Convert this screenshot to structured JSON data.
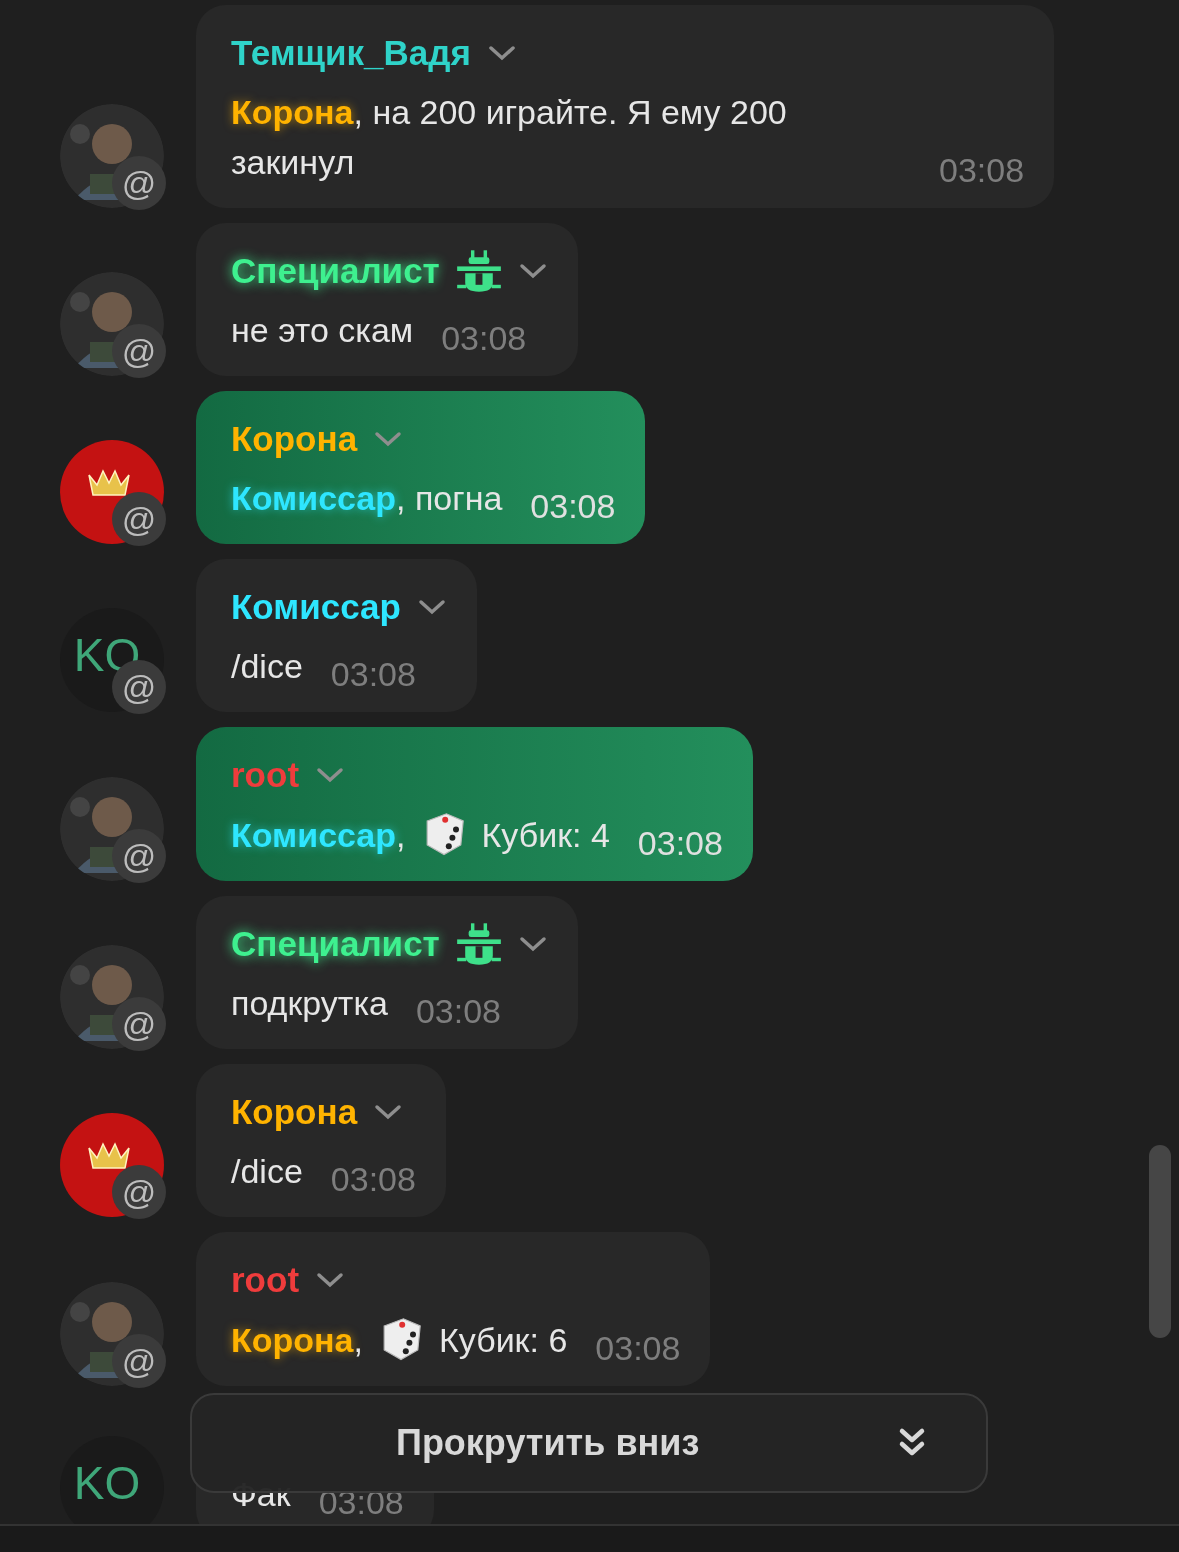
{
  "messages": [
    {
      "avatar": {
        "kind": "picture",
        "badge": "@"
      },
      "author": {
        "name": "Темщик_Вадя",
        "color": "#2fd3c9"
      },
      "highlighted": false,
      "body": [
        {
          "kind": "mention",
          "text": "Корона",
          "color": "#ffb300"
        },
        {
          "kind": "text",
          "text": ", на 200 играйте. Я ему 200 закинул"
        }
      ],
      "time": "03:08"
    },
    {
      "avatar": {
        "kind": "picture",
        "badge": "@"
      },
      "author": {
        "name": "Специалист",
        "color": "#3ef08f",
        "bug_badge": true
      },
      "highlighted": false,
      "body": [
        {
          "kind": "text",
          "text": "не это скам"
        }
      ],
      "time": "03:08"
    },
    {
      "avatar": {
        "kind": "crown",
        "badge": "@"
      },
      "author": {
        "name": "Корона",
        "color": "#ffb300"
      },
      "highlighted": true,
      "body": [
        {
          "kind": "mention",
          "text": "Комиссар",
          "color": "#2ee6ff"
        },
        {
          "kind": "text",
          "text": ", погна"
        }
      ],
      "time": "03:08"
    },
    {
      "avatar": {
        "kind": "initials",
        "initials": "KO",
        "badge": "@"
      },
      "author": {
        "name": "Комиссар",
        "color": "#2ee6ff"
      },
      "highlighted": false,
      "body": [
        {
          "kind": "text",
          "text": "/dice"
        }
      ],
      "time": "03:08"
    },
    {
      "avatar": {
        "kind": "picture",
        "badge": "@"
      },
      "author": {
        "name": "root",
        "color": "#ef3c3c"
      },
      "highlighted": true,
      "body": [
        {
          "kind": "mention",
          "text": "Комиссар",
          "color": "#2ee6ff"
        },
        {
          "kind": "text",
          "text": ","
        },
        {
          "kind": "dice"
        },
        {
          "kind": "text",
          "text": "Кубик: 4"
        }
      ],
      "time": "03:08"
    },
    {
      "avatar": {
        "kind": "picture",
        "badge": "@"
      },
      "author": {
        "name": "Специалист",
        "color": "#3ef08f",
        "bug_badge": true
      },
      "highlighted": false,
      "body": [
        {
          "kind": "text",
          "text": "подкрутка"
        }
      ],
      "time": "03:08"
    },
    {
      "avatar": {
        "kind": "crown",
        "badge": "@"
      },
      "author": {
        "name": "Корона",
        "color": "#ffb300"
      },
      "highlighted": false,
      "body": [
        {
          "kind": "text",
          "text": "/dice"
        }
      ],
      "time": "03:08"
    },
    {
      "avatar": {
        "kind": "picture",
        "badge": "@"
      },
      "author": {
        "name": "root",
        "color": "#ef3c3c"
      },
      "highlighted": false,
      "body": [
        {
          "kind": "mention",
          "text": "Корона",
          "color": "#ffb300"
        },
        {
          "kind": "text",
          "text": ","
        },
        {
          "kind": "dice"
        },
        {
          "kind": "text",
          "text": "Кубик: 6"
        }
      ],
      "time": "03:08"
    },
    {
      "avatar": {
        "kind": "initials",
        "initials": "KO"
      },
      "highlighted": false,
      "body": [
        {
          "kind": "text",
          "text": "Фак"
        }
      ],
      "time": "03:08"
    }
  ],
  "scroll_button": {
    "label": "Прокрутить вниз"
  }
}
